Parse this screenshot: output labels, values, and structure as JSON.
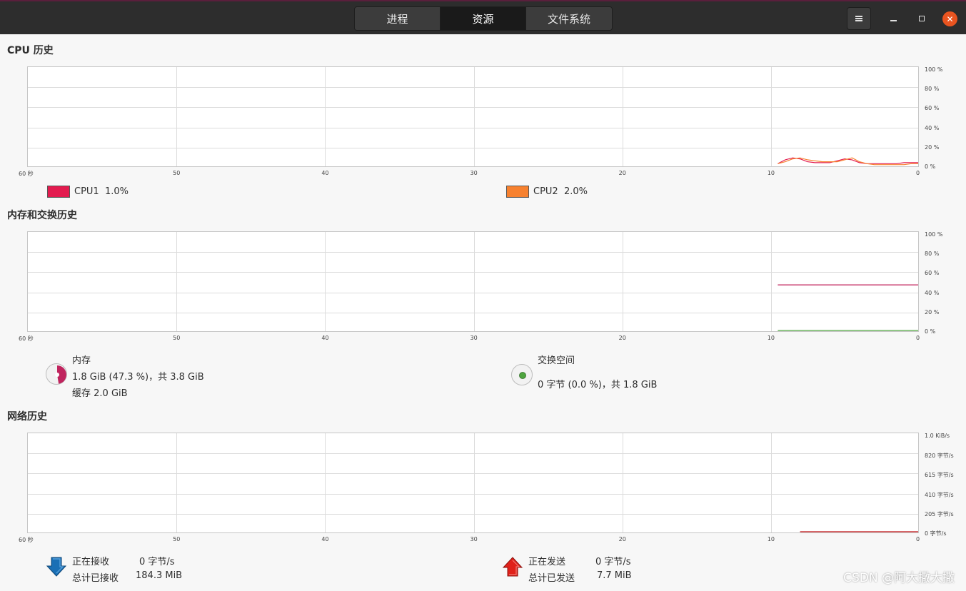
{
  "header": {
    "tabs": [
      "进程",
      "资源",
      "文件系统"
    ],
    "active_tab": 1
  },
  "cpu": {
    "title": "CPU 历史",
    "x_ticks": [
      "60 秒",
      "50",
      "40",
      "30",
      "20",
      "10",
      "0"
    ],
    "y_ticks": [
      "100 %",
      "80 %",
      "60 %",
      "40 %",
      "20 %",
      "0 %"
    ],
    "legend": [
      {
        "name": "CPU1",
        "value": "1.0%",
        "color": "#e31b4f"
      },
      {
        "name": "CPU2",
        "value": "2.0%",
        "color": "#f7812f"
      }
    ]
  },
  "memory": {
    "title": "内存和交换历史",
    "x_ticks": [
      "60 秒",
      "50",
      "40",
      "30",
      "20",
      "10",
      "0"
    ],
    "y_ticks": [
      "100 %",
      "80 %",
      "60 %",
      "40 %",
      "20 %",
      "0 %"
    ],
    "mem_label": "内存",
    "mem_detail": "1.8 GiB (47.3 %)，共 3.8 GiB",
    "mem_cache": "缓存 2.0 GiB",
    "mem_color": "#c0245e",
    "swap_label": "交换空间",
    "swap_detail": "0 字节 (0.0 %)，共 1.8 GiB",
    "swap_color": "#4ea53f"
  },
  "network": {
    "title": "网络历史",
    "x_ticks": [
      "60 秒",
      "50",
      "40",
      "30",
      "20",
      "10",
      "0"
    ],
    "y_ticks": [
      "1.0 KiB/s",
      "820 字节/s",
      "615 字节/s",
      "410 字节/s",
      "205 字节/s",
      "0 字节/s"
    ],
    "recv_label": "正在接收",
    "recv_rate": "0 字节/s",
    "recv_total_label": "总计已接收",
    "recv_total": "184.3 MiB",
    "recv_color": "#1a6fb5",
    "send_label": "正在发送",
    "send_rate": "0 字节/s",
    "send_total_label": "总计已发送",
    "send_total": "7.7 MiB",
    "send_color": "#e0211a"
  },
  "chart_data": [
    {
      "type": "line",
      "title": "CPU 历史",
      "x_unit": "秒",
      "x": [
        9.5,
        9.0,
        8.5,
        8.0,
        7.5,
        7.0,
        6.5,
        6.0,
        5.5,
        5.0,
        4.5,
        4.0,
        3.5,
        3.0,
        2.5,
        2.0,
        1.5,
        1.0,
        0.5,
        0
      ],
      "xlim": [
        60,
        0
      ],
      "ylim": [
        0,
        100
      ],
      "series": [
        {
          "name": "CPU1",
          "values": [
            2,
            6,
            8,
            7,
            4,
            3,
            3,
            3,
            5,
            7,
            6,
            3,
            2,
            2,
            2,
            2,
            2,
            3,
            3,
            3
          ]
        },
        {
          "name": "CPU2",
          "values": [
            2,
            4,
            7,
            8,
            6,
            5,
            4,
            4,
            4,
            6,
            8,
            4,
            2,
            1,
            1,
            1,
            1,
            1,
            2,
            2
          ]
        }
      ]
    },
    {
      "type": "line",
      "title": "内存和交换历史",
      "x_unit": "秒",
      "x": [
        9.5,
        0
      ],
      "xlim": [
        60,
        0
      ],
      "ylim": [
        0,
        100
      ],
      "series": [
        {
          "name": "内存",
          "values": [
            47.3,
            47.3
          ]
        },
        {
          "name": "交换空间",
          "values": [
            0.0,
            0.0
          ]
        }
      ]
    },
    {
      "type": "line",
      "title": "网络历史",
      "x_unit": "秒",
      "x": [
        8.0,
        0
      ],
      "xlim": [
        60,
        0
      ],
      "ylim": [
        0,
        1.0
      ],
      "series": [
        {
          "name": "正在接收",
          "values": [
            0,
            0
          ]
        },
        {
          "name": "正在发送",
          "values": [
            0,
            0
          ]
        }
      ]
    }
  ],
  "watermark": "CSDN @阿大撒大撒"
}
